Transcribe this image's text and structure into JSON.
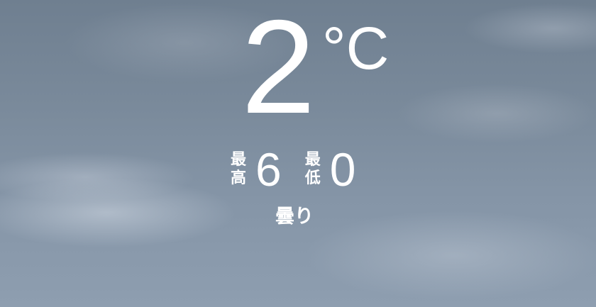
{
  "current": {
    "temperature": "2",
    "unit": "°C",
    "condition": "曇り"
  },
  "high": {
    "label_line1": "最",
    "label_line2": "高",
    "value": "6"
  },
  "low": {
    "label_line1": "最",
    "label_line2": "低",
    "value": "0"
  },
  "colors": {
    "text": "#ffffff",
    "sky": "#8190a0"
  }
}
